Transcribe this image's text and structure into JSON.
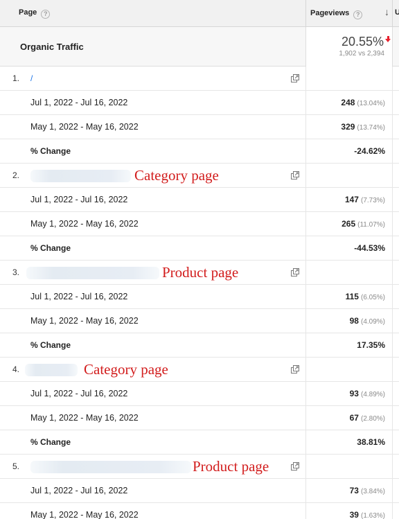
{
  "header": {
    "page_label": "Page",
    "pageviews_label": "Pageviews",
    "help_glyph": "?",
    "sort_glyph": "↓",
    "next_column_label": "U"
  },
  "summary": {
    "label": "Organic Traffic",
    "value": "20.55%",
    "comparison": "1,902 vs 2,394",
    "trend": "down",
    "trend_color": "#e8212e"
  },
  "link_color": "#1a73e8",
  "annotation_color": "#d21d1d",
  "rows": [
    {
      "number": "1.",
      "path": "/",
      "annotation": "",
      "period1": {
        "date": "Jul 1, 2022 - Jul 16, 2022",
        "value": "248",
        "pct": "(13.04%)"
      },
      "period2": {
        "date": "May 1, 2022 - May 16, 2022",
        "value": "329",
        "pct": "(13.74%)"
      },
      "change": {
        "label": "% Change",
        "value": "-24.62%"
      }
    },
    {
      "number": "2.",
      "path": "",
      "annotation": "Category page",
      "period1": {
        "date": "Jul 1, 2022 - Jul 16, 2022",
        "value": "147",
        "pct": "(7.73%)"
      },
      "period2": {
        "date": "May 1, 2022 - May 16, 2022",
        "value": "265",
        "pct": "(11.07%)"
      },
      "change": {
        "label": "% Change",
        "value": "-44.53%"
      }
    },
    {
      "number": "3.",
      "path": "",
      "annotation": "Product page",
      "period1": {
        "date": "Jul 1, 2022 - Jul 16, 2022",
        "value": "115",
        "pct": "(6.05%)"
      },
      "period2": {
        "date": "May 1, 2022 - May 16, 2022",
        "value": "98",
        "pct": "(4.09%)"
      },
      "change": {
        "label": "% Change",
        "value": "17.35%"
      }
    },
    {
      "number": "4.",
      "path": "",
      "annotation": "Category page",
      "period1": {
        "date": "Jul 1, 2022 - Jul 16, 2022",
        "value": "93",
        "pct": "(4.89%)"
      },
      "period2": {
        "date": "May 1, 2022 - May 16, 2022",
        "value": "67",
        "pct": "(2.80%)"
      },
      "change": {
        "label": "% Change",
        "value": "38.81%"
      }
    },
    {
      "number": "5.",
      "path": "",
      "annotation": "Product page",
      "period1": {
        "date": "Jul 1, 2022 - Jul 16, 2022",
        "value": "73",
        "pct": "(3.84%)"
      },
      "period2": {
        "date": "May 1, 2022 - May 16, 2022",
        "value": "39",
        "pct": "(1.63%)"
      }
    }
  ],
  "icons": {
    "open_link": "external-link-icon",
    "help": "help-icon",
    "sort": "sort-down-icon",
    "trend": "trend-down-icon"
  }
}
